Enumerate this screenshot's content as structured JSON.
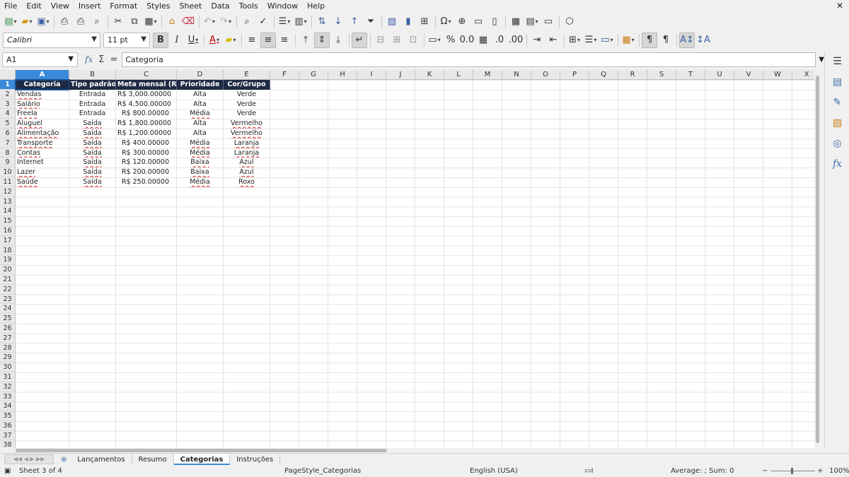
{
  "menu": [
    "File",
    "Edit",
    "View",
    "Insert",
    "Format",
    "Styles",
    "Sheet",
    "Data",
    "Tools",
    "Window",
    "Help"
  ],
  "font": {
    "name": "Calibri",
    "size": "11 pt"
  },
  "formula": {
    "cell_ref": "A1",
    "content": "Categoria",
    "fx_label": "fx",
    "sum_label": "Σ",
    "eq_label": "="
  },
  "columns": [
    "A",
    "B",
    "C",
    "D",
    "E",
    "F",
    "G",
    "H",
    "I",
    "J",
    "K",
    "L",
    "M",
    "N",
    "O",
    "P",
    "Q",
    "R",
    "S",
    "T",
    "U",
    "V",
    "W",
    "X"
  ],
  "rows": [
    "1",
    "2",
    "3",
    "4",
    "5",
    "6",
    "7",
    "8",
    "9",
    "10",
    "11",
    "12",
    "13",
    "14",
    "15",
    "16",
    "17",
    "18",
    "19",
    "20",
    "21",
    "22",
    "23",
    "24",
    "25",
    "26",
    "27",
    "28",
    "29",
    "30",
    "31",
    "32",
    "33",
    "34",
    "35",
    "36",
    "37",
    "38"
  ],
  "table": {
    "headers": [
      "Categoria",
      "Tipo padrão",
      "Meta mensal (R$)",
      "Prioridade",
      "Cor/Grupo"
    ],
    "rows": [
      [
        "Vendas",
        "Entrada",
        "R$ 3,000.00000",
        "Alta",
        "Verde"
      ],
      [
        "Salário",
        "Entrada",
        "R$ 4,500.00000",
        "Alta",
        "Verde"
      ],
      [
        "Freela",
        "Entrada",
        "R$ 800.00000",
        "Média",
        "Verde"
      ],
      [
        "Aluguel",
        "Saída",
        "R$ 1,800.00000",
        "Alta",
        "Vermelho"
      ],
      [
        "Alimentação",
        "Saída",
        "R$ 1,200.00000",
        "Alta",
        "Vermelho"
      ],
      [
        "Transporte",
        "Saída",
        "R$ 400.00000",
        "Média",
        "Laranja"
      ],
      [
        "Contas",
        "Saída",
        "R$ 300.00000",
        "Média",
        "Laranja"
      ],
      [
        "Internet",
        "Saída",
        "R$ 120.00000",
        "Baixa",
        "Azul"
      ],
      [
        "Lazer",
        "Saída",
        "R$ 200.00000",
        "Baixa",
        "Azul"
      ],
      [
        "Saúde",
        "Saída",
        "R$ 250.00000",
        "Média",
        "Roxo"
      ]
    ]
  },
  "tabs": [
    "Lançamentos",
    "Resumo",
    "Categorias",
    "Instruções"
  ],
  "active_tab": "Categorias",
  "status": {
    "sheet": "Sheet 3 of 4",
    "page_style": "PageStyle_Categorias",
    "language": "English (USA)",
    "stats": "Average: ; Sum: 0",
    "zoom": "100%"
  },
  "colors": {
    "header_bg": "#1f2a44",
    "selection": "#3b8ad9",
    "accent": "#3b6fae"
  }
}
